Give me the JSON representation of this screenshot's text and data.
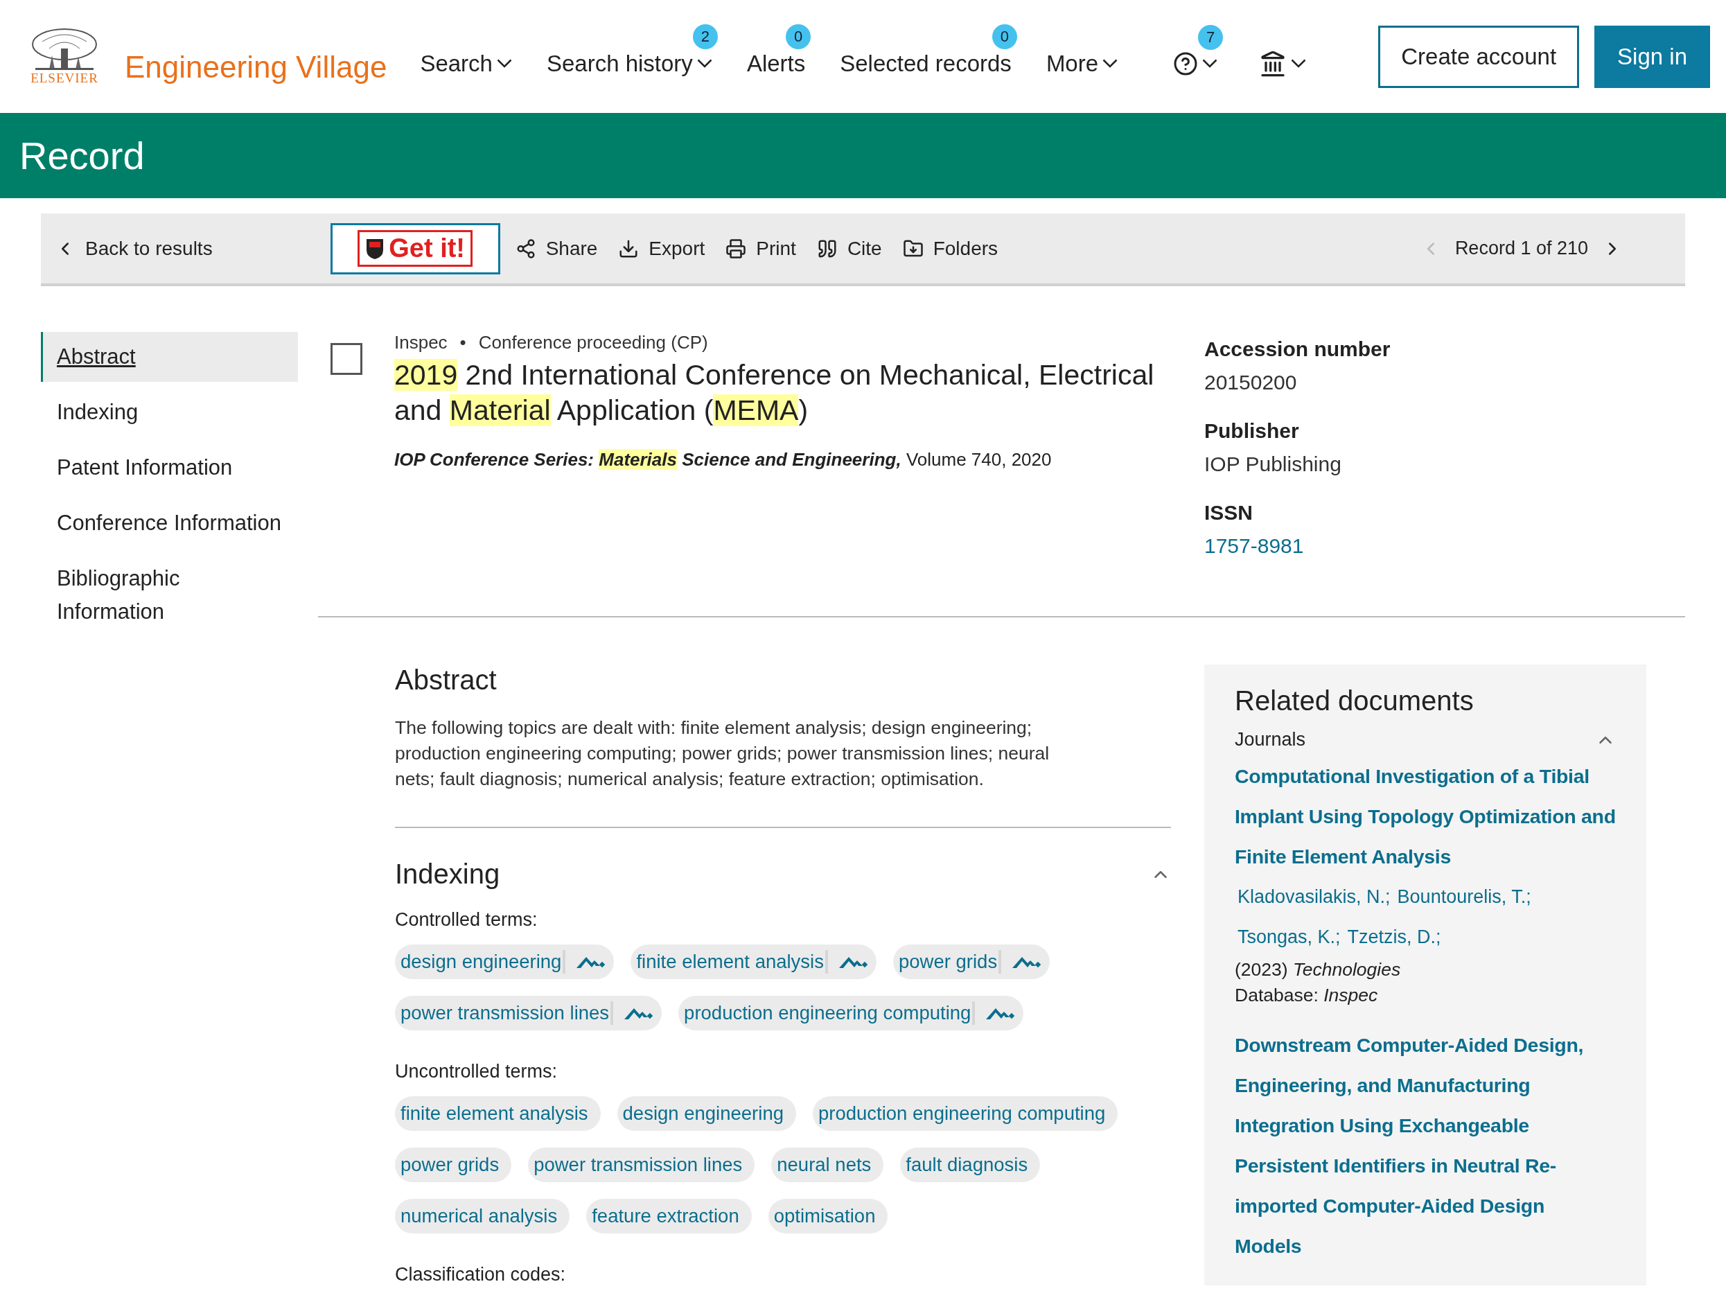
{
  "header": {
    "logo_text": "ELSEVIER",
    "brand": "Engineering Village",
    "nav": [
      {
        "kind": "menu",
        "label": "Search"
      },
      {
        "kind": "menu",
        "label": "Search history",
        "badge": "2"
      },
      {
        "kind": "link",
        "label": "Alerts",
        "badge": "0"
      },
      {
        "kind": "link",
        "label": "Selected records",
        "badge": "0"
      },
      {
        "kind": "menu",
        "label": "More"
      },
      {
        "kind": "help",
        "badge": "7"
      },
      {
        "kind": "institution"
      }
    ],
    "buttons": [
      {
        "kind": "outline",
        "label": "Create account"
      },
      {
        "kind": "filled",
        "label": "Sign in"
      }
    ]
  },
  "banner": {
    "title": "Record"
  },
  "toolbar": {
    "back": "Back to results",
    "get_it": "Get it!",
    "actions": [
      {
        "kind": "share",
        "label": "Share"
      },
      {
        "kind": "export",
        "label": "Export"
      },
      {
        "kind": "print",
        "label": "Print"
      },
      {
        "kind": "cite",
        "label": "Cite"
      },
      {
        "kind": "folders",
        "label": "Folders"
      }
    ],
    "record_position": "Record 1 of 210",
    "prev_disabled": true
  },
  "sidebar": {
    "items": [
      {
        "label": "Abstract",
        "selected": true
      },
      {
        "label": "Indexing",
        "selected": false
      },
      {
        "label": "Patent Information",
        "selected": false
      },
      {
        "label": "Conference Information",
        "selected": false
      },
      {
        "label": "Bibliographic Information",
        "selected": false
      }
    ]
  },
  "record": {
    "checked": false,
    "database": "Inspec",
    "separator": "•",
    "doc_type": "Conference proceeding (CP)",
    "title": [
      {
        "text": "2019",
        "highlight": true
      },
      {
        "text": " 2nd International Conference on Mechanical, Electrical and ",
        "highlight": false
      },
      {
        "text": "Material",
        "highlight": true
      },
      {
        "text": " Application (",
        "highlight": false
      },
      {
        "text": "MEMA",
        "highlight": true
      },
      {
        "text": ")",
        "highlight": false
      }
    ],
    "source": [
      {
        "text": "IOP Conference Series: ",
        "highlight": false,
        "kind": "journal"
      },
      {
        "text": "Materials",
        "highlight": true,
        "kind": "journal"
      },
      {
        "text": " Science and Engineering,",
        "highlight": false,
        "kind": "journal"
      },
      {
        "text": " Volume 740, 2020",
        "highlight": false,
        "kind": "plain"
      }
    ],
    "meta": [
      {
        "label": "Accession number",
        "value": "20150200",
        "kind": "text"
      },
      {
        "label": "Publisher",
        "value": "IOP Publishing",
        "kind": "text"
      },
      {
        "label": "ISSN",
        "value": "1757-8981",
        "kind": "link"
      }
    ]
  },
  "abstract": {
    "heading": "Abstract",
    "text": "The following topics are dealt with: finite element analysis; design engineering; production engineering computing; power grids; power transmission lines; neural nets; fault diagnosis; numerical analysis; feature extraction; optimisation."
  },
  "indexing": {
    "heading": "Indexing",
    "expanded": true,
    "controlled_label": "Controlled terms:",
    "controlled_terms": [
      "design engineering",
      "finite element analysis",
      "power grids",
      "power transmission lines",
      "production engineering computing"
    ],
    "uncontrolled_label": "Uncontrolled terms:",
    "uncontrolled_terms": [
      "finite element analysis",
      "design engineering",
      "production engineering computing",
      "power grids",
      "power transmission lines",
      "neural nets",
      "fault diagnosis",
      "numerical analysis",
      "feature extraction",
      "optimisation"
    ],
    "classification_label": "Classification codes:"
  },
  "related": {
    "heading": "Related documents",
    "group": "Journals",
    "expanded": true,
    "documents": [
      {
        "title": "Computational Investigation of a Tibial Implant Using Topology Optimization and Finite Element Analysis",
        "author_lines": [
          [
            "Kladovasilakis, N.;",
            "Bountourelis, T.;"
          ],
          [
            "Tsongas, K.;",
            "Tzetzis, D.;"
          ]
        ],
        "citation": "(2023) *Technologies*",
        "database": "Database: *Inspec*"
      },
      {
        "title": "Downstream Computer-Aided Design, Engineering, and Manufacturing Integration Using Exchangeable Persistent Identifiers in Neutral Re-imported Computer-Aided Design Models"
      }
    ]
  }
}
